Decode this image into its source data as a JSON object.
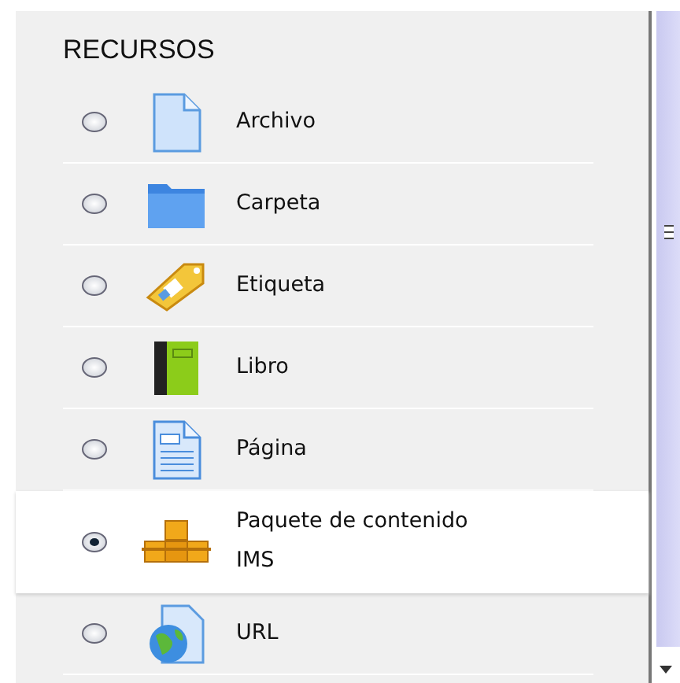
{
  "section": {
    "title": "RECURSOS"
  },
  "resources": [
    {
      "kind": "file",
      "label": "Archivo",
      "selected": false
    },
    {
      "kind": "folder",
      "label": "Carpeta",
      "selected": false
    },
    {
      "kind": "label",
      "label": "Etiqueta",
      "selected": false
    },
    {
      "kind": "book",
      "label": "Libro",
      "selected": false
    },
    {
      "kind": "page",
      "label": "Página",
      "selected": false
    },
    {
      "kind": "package",
      "label": "Paquete de contenido IMS",
      "selected": true
    },
    {
      "kind": "url",
      "label": "URL",
      "selected": false
    }
  ]
}
